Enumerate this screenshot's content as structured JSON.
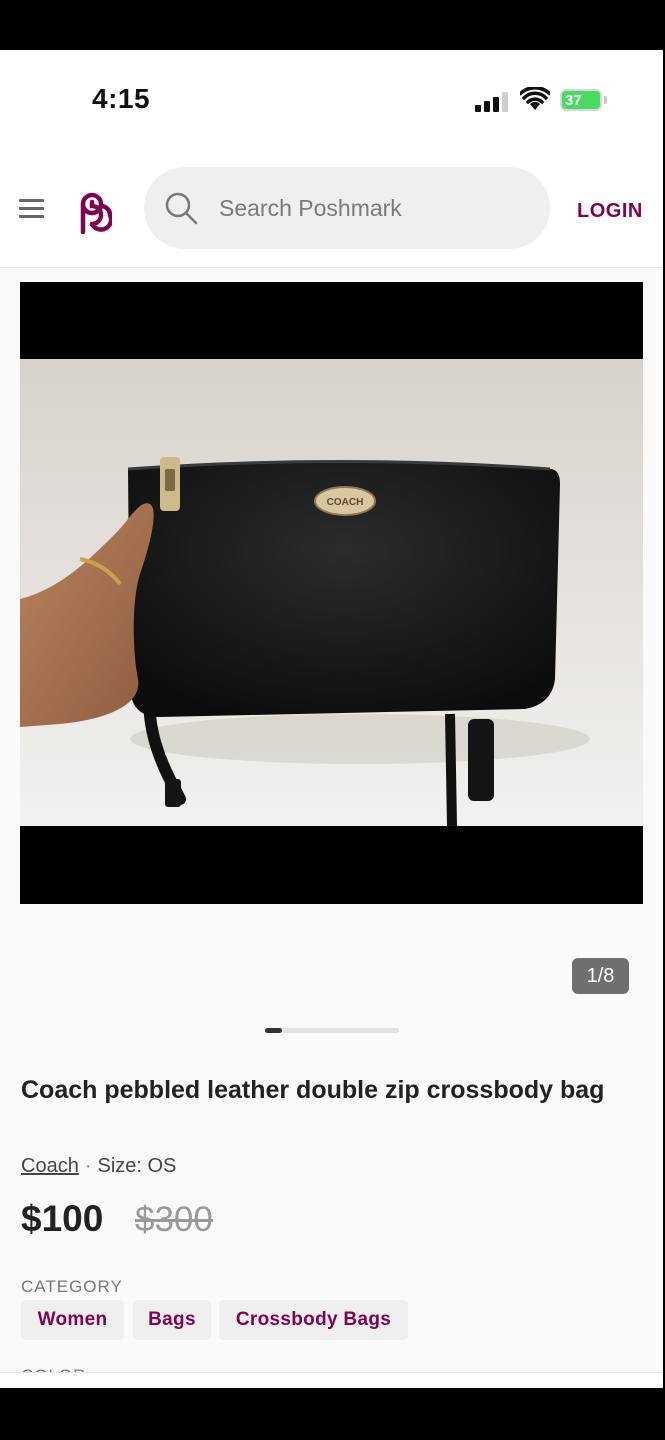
{
  "status_bar": {
    "time": "4:15",
    "battery": "37"
  },
  "header": {
    "search_placeholder": "Search Poshmark",
    "login_label": "LOGIN"
  },
  "listing": {
    "image_counter": "1/8",
    "title": "Coach pebbled leather double zip crossbody bag",
    "brand": "Coach",
    "size": "Size: OS",
    "price": "$100",
    "original_price": "$300",
    "category_label": "CATEGORY",
    "categories": [
      "Women",
      "Bags",
      "Crossbody Bags"
    ],
    "color_label": "COLOR",
    "image_logo_text": "COACH"
  },
  "colors": {
    "brand": "#7f0353",
    "battery": "#4cd964"
  }
}
